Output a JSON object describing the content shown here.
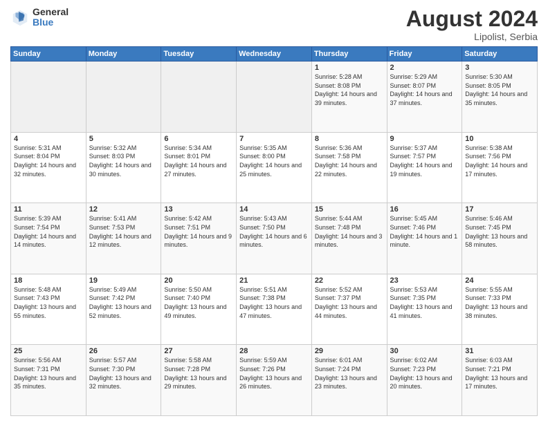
{
  "header": {
    "logo_general": "General",
    "logo_blue": "Blue",
    "month_year": "August 2024",
    "location": "Lipolist, Serbia"
  },
  "calendar": {
    "days_of_week": [
      "Sunday",
      "Monday",
      "Tuesday",
      "Wednesday",
      "Thursday",
      "Friday",
      "Saturday"
    ],
    "weeks": [
      [
        {
          "day": "",
          "empty": true
        },
        {
          "day": "",
          "empty": true
        },
        {
          "day": "",
          "empty": true
        },
        {
          "day": "",
          "empty": true
        },
        {
          "day": "1",
          "sunrise": "5:28 AM",
          "sunset": "8:08 PM",
          "daylight": "14 hours and 39 minutes."
        },
        {
          "day": "2",
          "sunrise": "5:29 AM",
          "sunset": "8:07 PM",
          "daylight": "14 hours and 37 minutes."
        },
        {
          "day": "3",
          "sunrise": "5:30 AM",
          "sunset": "8:05 PM",
          "daylight": "14 hours and 35 minutes."
        }
      ],
      [
        {
          "day": "4",
          "sunrise": "5:31 AM",
          "sunset": "8:04 PM",
          "daylight": "14 hours and 32 minutes."
        },
        {
          "day": "5",
          "sunrise": "5:32 AM",
          "sunset": "8:03 PM",
          "daylight": "14 hours and 30 minutes."
        },
        {
          "day": "6",
          "sunrise": "5:34 AM",
          "sunset": "8:01 PM",
          "daylight": "14 hours and 27 minutes."
        },
        {
          "day": "7",
          "sunrise": "5:35 AM",
          "sunset": "8:00 PM",
          "daylight": "14 hours and 25 minutes."
        },
        {
          "day": "8",
          "sunrise": "5:36 AM",
          "sunset": "7:58 PM",
          "daylight": "14 hours and 22 minutes."
        },
        {
          "day": "9",
          "sunrise": "5:37 AM",
          "sunset": "7:57 PM",
          "daylight": "14 hours and 19 minutes."
        },
        {
          "day": "10",
          "sunrise": "5:38 AM",
          "sunset": "7:56 PM",
          "daylight": "14 hours and 17 minutes."
        }
      ],
      [
        {
          "day": "11",
          "sunrise": "5:39 AM",
          "sunset": "7:54 PM",
          "daylight": "14 hours and 14 minutes."
        },
        {
          "day": "12",
          "sunrise": "5:41 AM",
          "sunset": "7:53 PM",
          "daylight": "14 hours and 12 minutes."
        },
        {
          "day": "13",
          "sunrise": "5:42 AM",
          "sunset": "7:51 PM",
          "daylight": "14 hours and 9 minutes."
        },
        {
          "day": "14",
          "sunrise": "5:43 AM",
          "sunset": "7:50 PM",
          "daylight": "14 hours and 6 minutes."
        },
        {
          "day": "15",
          "sunrise": "5:44 AM",
          "sunset": "7:48 PM",
          "daylight": "14 hours and 3 minutes."
        },
        {
          "day": "16",
          "sunrise": "5:45 AM",
          "sunset": "7:46 PM",
          "daylight": "14 hours and 1 minute."
        },
        {
          "day": "17",
          "sunrise": "5:46 AM",
          "sunset": "7:45 PM",
          "daylight": "13 hours and 58 minutes."
        }
      ],
      [
        {
          "day": "18",
          "sunrise": "5:48 AM",
          "sunset": "7:43 PM",
          "daylight": "13 hours and 55 minutes."
        },
        {
          "day": "19",
          "sunrise": "5:49 AM",
          "sunset": "7:42 PM",
          "daylight": "13 hours and 52 minutes."
        },
        {
          "day": "20",
          "sunrise": "5:50 AM",
          "sunset": "7:40 PM",
          "daylight": "13 hours and 49 minutes."
        },
        {
          "day": "21",
          "sunrise": "5:51 AM",
          "sunset": "7:38 PM",
          "daylight": "13 hours and 47 minutes."
        },
        {
          "day": "22",
          "sunrise": "5:52 AM",
          "sunset": "7:37 PM",
          "daylight": "13 hours and 44 minutes."
        },
        {
          "day": "23",
          "sunrise": "5:53 AM",
          "sunset": "7:35 PM",
          "daylight": "13 hours and 41 minutes."
        },
        {
          "day": "24",
          "sunrise": "5:55 AM",
          "sunset": "7:33 PM",
          "daylight": "13 hours and 38 minutes."
        }
      ],
      [
        {
          "day": "25",
          "sunrise": "5:56 AM",
          "sunset": "7:31 PM",
          "daylight": "13 hours and 35 minutes."
        },
        {
          "day": "26",
          "sunrise": "5:57 AM",
          "sunset": "7:30 PM",
          "daylight": "13 hours and 32 minutes."
        },
        {
          "day": "27",
          "sunrise": "5:58 AM",
          "sunset": "7:28 PM",
          "daylight": "13 hours and 29 minutes."
        },
        {
          "day": "28",
          "sunrise": "5:59 AM",
          "sunset": "7:26 PM",
          "daylight": "13 hours and 26 minutes."
        },
        {
          "day": "29",
          "sunrise": "6:01 AM",
          "sunset": "7:24 PM",
          "daylight": "13 hours and 23 minutes."
        },
        {
          "day": "30",
          "sunrise": "6:02 AM",
          "sunset": "7:23 PM",
          "daylight": "13 hours and 20 minutes."
        },
        {
          "day": "31",
          "sunrise": "6:03 AM",
          "sunset": "7:21 PM",
          "daylight": "13 hours and 17 minutes."
        }
      ]
    ]
  }
}
